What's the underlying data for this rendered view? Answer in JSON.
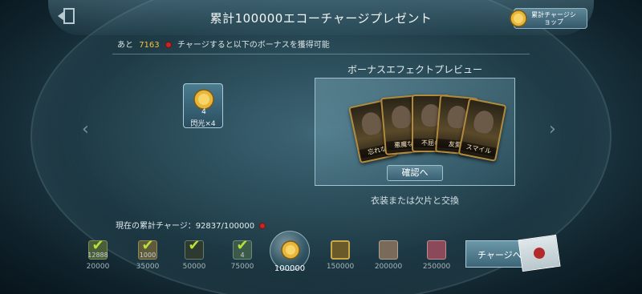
{
  "header": {
    "title": "累計100000エコーチャージプレゼント",
    "shop_button_label": "累計チャージショップ"
  },
  "progress_info": {
    "prefix": "あと",
    "remaining_amount": "7163",
    "suffix": "チャージすると以下のボーナスを獲得可能"
  },
  "reward": {
    "count": "4",
    "label": "閃光×4"
  },
  "preview": {
    "title": "ボーナスエフェクトプレビュー",
    "confirm_label": "確認へ",
    "exchange_note": "衣装または欠片と交換",
    "cards": [
      {
        "caption": "忘れな"
      },
      {
        "caption": "悪魔な"
      },
      {
        "caption": "不屈の"
      },
      {
        "caption": "友愛"
      },
      {
        "caption": "スマイル"
      }
    ]
  },
  "current_charge": {
    "label": "現在の累計チャージ：92837/100000"
  },
  "tiers": [
    {
      "threshold": "20000",
      "sub": "12888",
      "claimed": true
    },
    {
      "threshold": "35000",
      "sub": "1000",
      "claimed": true
    },
    {
      "threshold": "50000",
      "sub": "",
      "claimed": true
    },
    {
      "threshold": "75000",
      "sub": "4",
      "claimed": true
    },
    {
      "threshold": "100000",
      "sub": "",
      "claimed": false
    },
    {
      "threshold": "150000",
      "sub": "",
      "claimed": false
    },
    {
      "threshold": "200000",
      "sub": "",
      "claimed": false
    },
    {
      "threshold": "250000",
      "sub": "",
      "claimed": false
    }
  ],
  "charge_button": {
    "label": "チャージへ"
  },
  "colors": {
    "accent_gold": "#f2c53d",
    "check_green": "#b7e03a",
    "echo_red": "#c32828"
  }
}
